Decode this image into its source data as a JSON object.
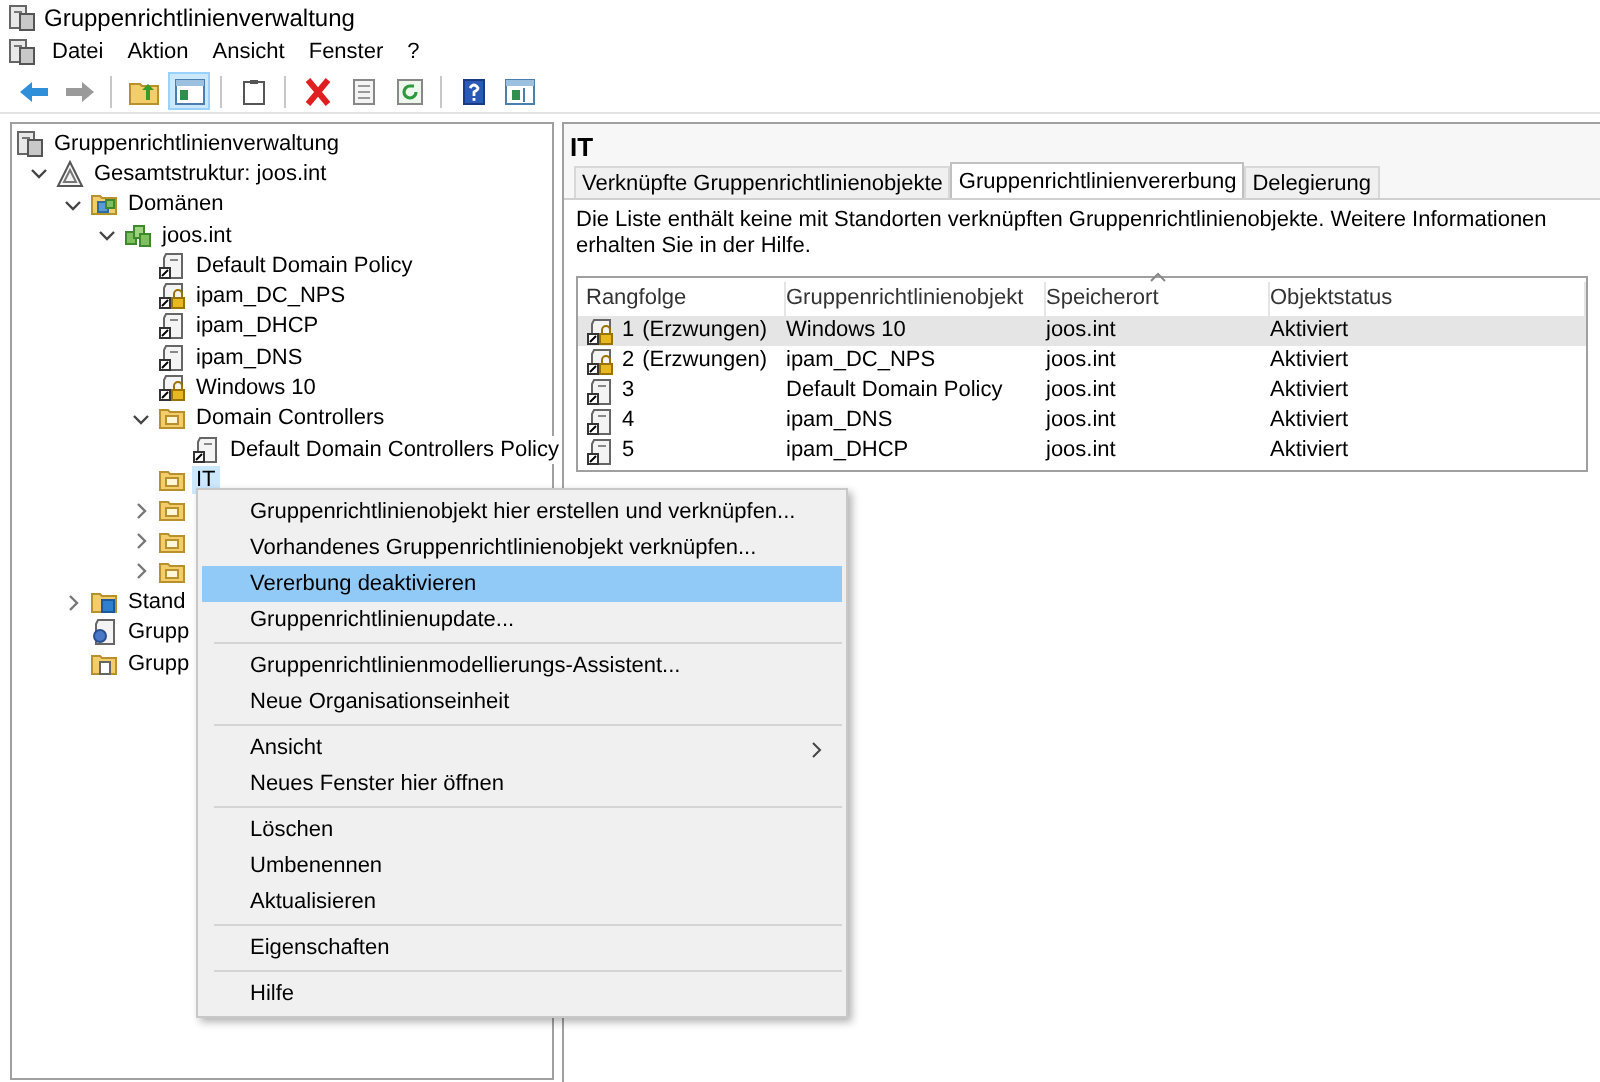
{
  "window": {
    "title": "Gruppenrichtlinienverwaltung"
  },
  "menu_bar": [
    "Datei",
    "Aktion",
    "Ansicht",
    "Fenster",
    "?"
  ],
  "toolbar": [
    {
      "kind": "back",
      "pressed": false
    },
    {
      "kind": "forward",
      "pressed": false
    },
    {
      "kind": "separator"
    },
    {
      "kind": "up",
      "pressed": false
    },
    {
      "kind": "tree",
      "pressed": true
    },
    {
      "kind": "separator"
    },
    {
      "kind": "properties",
      "pressed": false
    },
    {
      "kind": "separator"
    },
    {
      "kind": "delete",
      "pressed": false
    },
    {
      "kind": "export",
      "pressed": false
    },
    {
      "kind": "refresh",
      "pressed": false
    },
    {
      "kind": "separator"
    },
    {
      "kind": "help",
      "pressed": false
    },
    {
      "kind": "pane",
      "pressed": false
    }
  ],
  "tree": [
    {
      "label": "Gruppenrichtlinienverwaltung",
      "kind": "console",
      "selected": false,
      "children": [
        {
          "label": "Gesamtstruktur: joos.int",
          "kind": "forest",
          "expanded": true,
          "selected": false,
          "children": [
            {
              "label": "Domänen",
              "kind": "domains",
              "expanded": true,
              "selected": false,
              "children": [
                {
                  "label": "joos.int",
                  "kind": "domain",
                  "expanded": true,
                  "selected": false,
                  "children": [
                    {
                      "label": "Default Domain Policy",
                      "kind": "gpo",
                      "selected": false
                    },
                    {
                      "label": "ipam_DC_NPS",
                      "kind": "gpo-enforced",
                      "selected": false
                    },
                    {
                      "label": "ipam_DHCP",
                      "kind": "gpo",
                      "selected": false
                    },
                    {
                      "label": "ipam_DNS",
                      "kind": "gpo",
                      "selected": false
                    },
                    {
                      "label": "Windows 10",
                      "kind": "gpo-enforced",
                      "selected": false
                    },
                    {
                      "label": "Domain Controllers",
                      "kind": "ou",
                      "expanded": true,
                      "selected": false,
                      "children": [
                        {
                          "label": "Default Domain Controllers Policy",
                          "kind": "gpo",
                          "selected": false
                        }
                      ]
                    },
                    {
                      "label": "IT",
                      "kind": "ou",
                      "selected": true
                    },
                    {
                      "kind": "ou",
                      "expanded": false,
                      "selected": false
                    },
                    {
                      "kind": "ou",
                      "expanded": false,
                      "selected": false
                    },
                    {
                      "kind": "ou",
                      "expanded": false,
                      "selected": false
                    }
                  ]
                }
              ]
            },
            {
              "label": "Stand",
              "kind": "sites",
              "expanded": false,
              "selected": false
            },
            {
              "label": "Grupp",
              "kind": "modeling",
              "selected": false
            },
            {
              "label": "Grupp",
              "kind": "results",
              "selected": false
            }
          ]
        }
      ]
    }
  ],
  "details": {
    "title": "IT",
    "tabs": [
      {
        "label": "Verknüpfte Gruppenrichtlinienobjekte",
        "selected": false
      },
      {
        "label": "Gruppenrichtlinienvererbung",
        "selected": true
      },
      {
        "label": "Delegierung",
        "selected": false
      }
    ],
    "info": "Die Liste enthält keine mit Standorten verknüpften Gruppenrichtlinienobjekte. Weitere Informationen erhalten Sie in der Hilfe.",
    "table": {
      "columns": [
        {
          "label": "Rangfolge",
          "sorted": false
        },
        {
          "label": "Gruppenrichtlinienobjekt",
          "sorted": false
        },
        {
          "label": "Speicherort",
          "sorted": true
        },
        {
          "label": "Objektstatus",
          "sorted": false
        }
      ],
      "rows": [
        {
          "kind": "gpo-enforced",
          "rank": "1",
          "enforced": "(Erzwungen)",
          "gpo": "Windows 10",
          "location": "joos.int",
          "status": "Aktiviert",
          "selected": true
        },
        {
          "kind": "gpo-enforced",
          "rank": "2",
          "enforced": "(Erzwungen)",
          "gpo": "ipam_DC_NPS",
          "location": "joos.int",
          "status": "Aktiviert",
          "selected": false
        },
        {
          "kind": "gpo",
          "rank": "3",
          "gpo": "Default Domain Policy",
          "location": "joos.int",
          "status": "Aktiviert",
          "selected": false
        },
        {
          "kind": "gpo",
          "rank": "4",
          "gpo": "ipam_DNS",
          "location": "joos.int",
          "status": "Aktiviert",
          "selected": false
        },
        {
          "kind": "gpo",
          "rank": "5",
          "gpo": "ipam_DHCP",
          "location": "joos.int",
          "status": "Aktiviert",
          "selected": false
        }
      ]
    }
  },
  "context_menu": [
    [
      {
        "label": "Gruppenrichtlinienobjekt hier erstellen und verknüpfen...",
        "selected": false
      },
      {
        "label": "Vorhandenes Gruppenrichtlinienobjekt verknüpfen...",
        "selected": false
      },
      {
        "label": "Vererbung deaktivieren",
        "selected": true
      },
      {
        "label": "Gruppenrichtlinienupdate...",
        "selected": false
      }
    ],
    [
      {
        "label": "Gruppenrichtlinienmodellierungs-Assistent...",
        "selected": false
      },
      {
        "label": "Neue Organisationseinheit",
        "selected": false
      }
    ],
    [
      {
        "label": "Ansicht",
        "selected": false,
        "submenu": true
      },
      {
        "label": "Neues Fenster hier öffnen",
        "selected": false
      }
    ],
    [
      {
        "label": "Löschen",
        "selected": false
      },
      {
        "label": "Umbenennen",
        "selected": false
      },
      {
        "label": "Aktualisieren",
        "selected": false
      }
    ],
    [
      {
        "label": "Eigenschaften",
        "selected": false
      }
    ],
    [
      {
        "label": "Hilfe",
        "selected": false
      }
    ]
  ]
}
